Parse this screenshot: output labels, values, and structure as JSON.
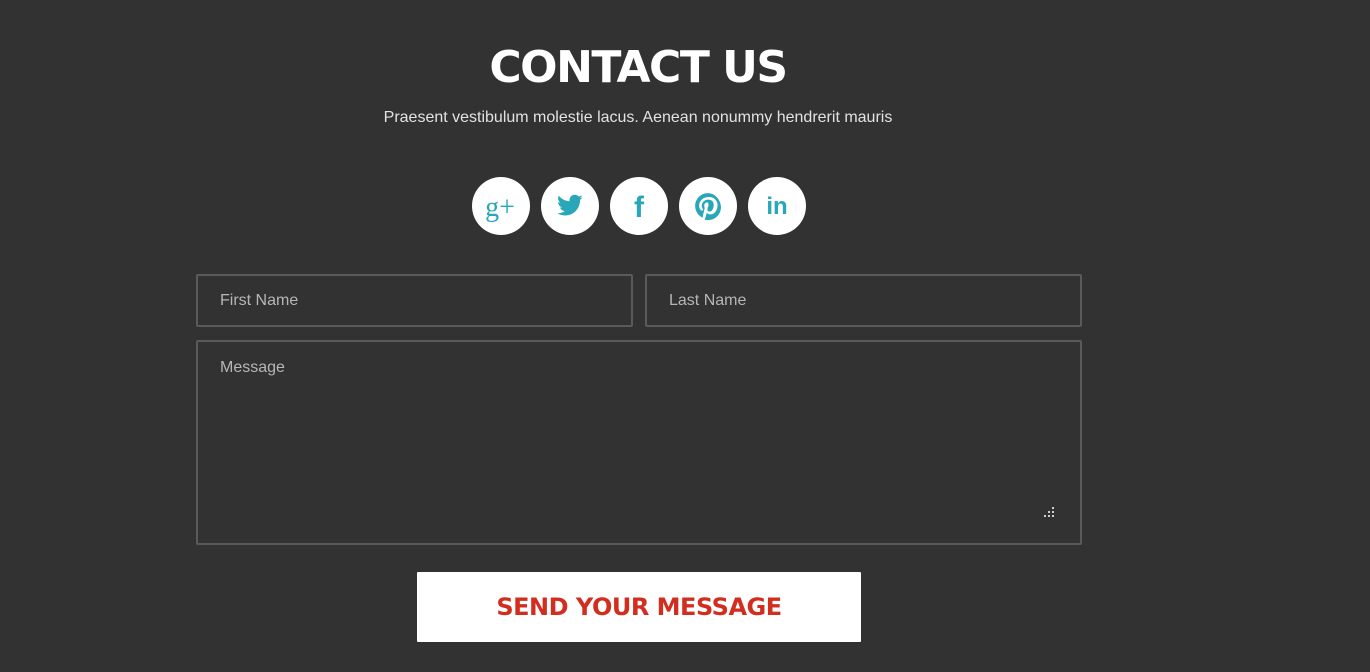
{
  "header": {
    "title": "CONTACT US",
    "subtitle": "Praesent vestibulum molestie lacus. Aenean nonummy hendrerit mauris"
  },
  "social": {
    "icon_color": "#29a7b9",
    "items": [
      {
        "icon": "google-plus-icon",
        "glyph": "g+"
      },
      {
        "icon": "twitter-icon"
      },
      {
        "icon": "facebook-icon",
        "glyph": "f"
      },
      {
        "icon": "pinterest-icon"
      },
      {
        "icon": "linkedin-icon",
        "glyph": "in"
      }
    ]
  },
  "form": {
    "first_name_placeholder": "First Name",
    "last_name_placeholder": "Last Name",
    "message_placeholder": "Message",
    "submit_label": "SEND YOUR MESSAGE"
  },
  "colors": {
    "background": "#323232",
    "field_border": "#5a5a5a",
    "button_text": "#d22e1f",
    "button_background": "#ffffff"
  }
}
